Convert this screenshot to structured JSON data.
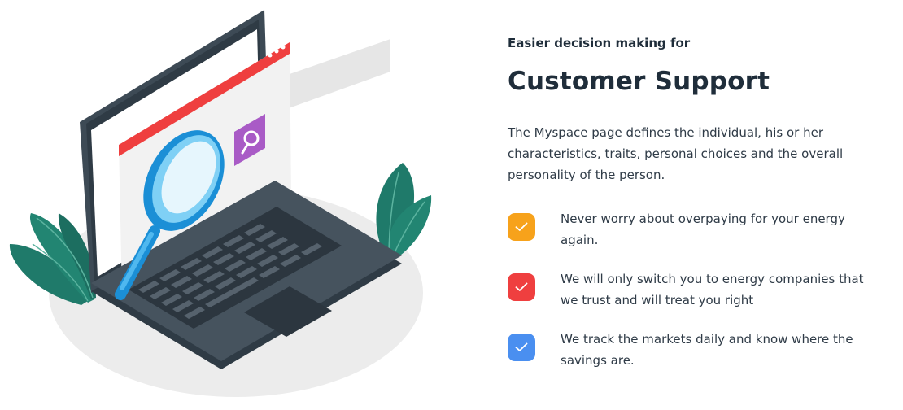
{
  "hero": {
    "eyebrow": "Easier decision making for",
    "title": "Customer Support",
    "description": "The Myspace page defines the individual, his or her characteristics, traits, personal choices and the overall personality of the person."
  },
  "illustration": {
    "name": "laptop-with-magnifier-icon"
  },
  "features": [
    {
      "text": "Never worry about overpaying for your energy again.",
      "color": "#f7a21b",
      "icon": "check-icon"
    },
    {
      "text": "We will only switch you to energy companies that we trust and will treat you right",
      "color": "#ef3f3f",
      "icon": "check-icon"
    },
    {
      "text": "We track the markets daily and know where the savings are.",
      "color": "#4a8ff0",
      "icon": "check-icon"
    }
  ]
}
